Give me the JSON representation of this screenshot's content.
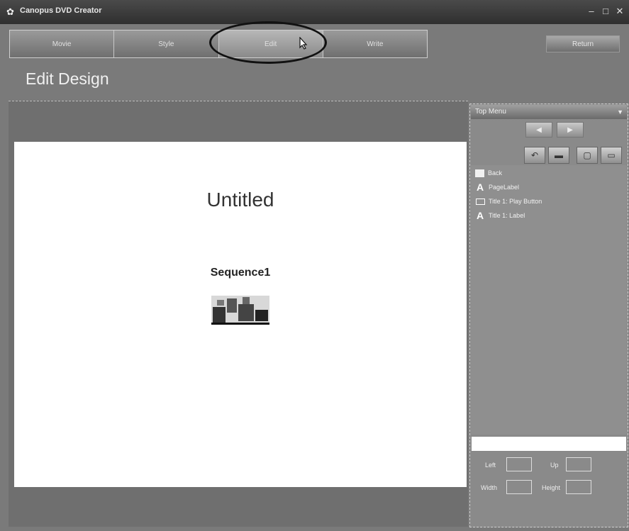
{
  "window": {
    "title": "Canopus DVD Creator",
    "controls": [
      "–",
      "□",
      "✕"
    ]
  },
  "steps": {
    "tabs": [
      {
        "label": "Movie"
      },
      {
        "label": "Style"
      },
      {
        "label": "Edit"
      },
      {
        "label": "Write"
      }
    ],
    "active": "Edit"
  },
  "toolbar": {
    "return_label": "Return"
  },
  "page": {
    "title": "Edit Design"
  },
  "canvas": {
    "menu_title": "Untitled",
    "chapter_label": "Sequence1",
    "thumbnail_icon": "sequence-thumbnail-icon"
  },
  "panel": {
    "menu_select": "Top Menu",
    "nav": {
      "prev": "◀",
      "next": "▶"
    },
    "tools": [
      "undo-icon",
      "folder-icon",
      "frame-icon",
      "monitor-icon"
    ],
    "layers": [
      {
        "icon": "background-icon",
        "label": "Back"
      },
      {
        "icon": "text-icon",
        "label": "PageLabel"
      },
      {
        "icon": "button-icon",
        "label": "Title 1: Play Button"
      },
      {
        "icon": "text-icon",
        "label": "Title 1: Label"
      }
    ],
    "props": {
      "left_label": "Left",
      "up_label": "Up",
      "width_label": "Width",
      "height_label": "Height"
    }
  }
}
